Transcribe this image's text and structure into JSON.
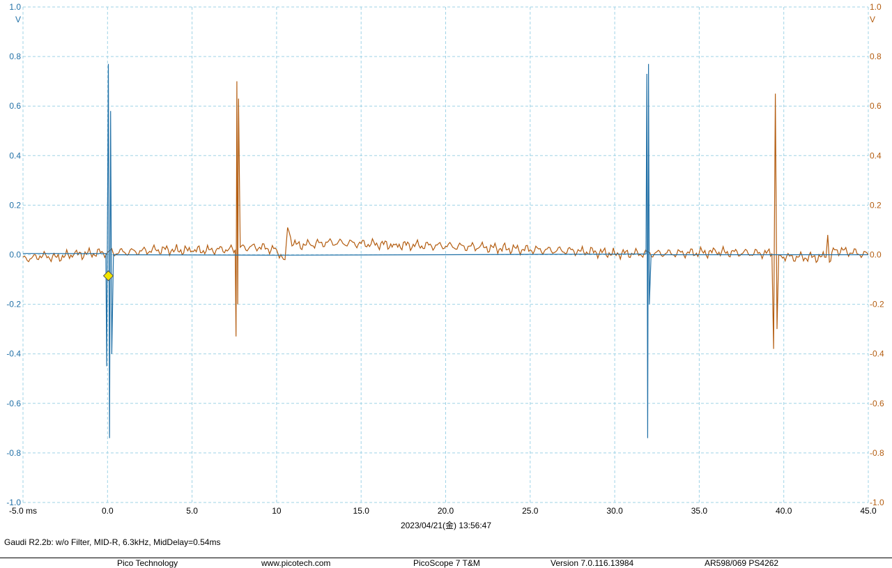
{
  "chart_data": {
    "type": "line",
    "title": "",
    "timestamp": "2023/04/21(金) 13:56:47",
    "xlabel": "",
    "x_unit": "ms",
    "xlim": [
      -5.0,
      45.0
    ],
    "x_ticks": [
      -5,
      0,
      5,
      10,
      15,
      20,
      25,
      30,
      35,
      40,
      45
    ],
    "x_tick_labels": [
      "-5.0 ms",
      "0.0",
      "5.0",
      "10",
      "15.0",
      "20.0",
      "25.0",
      "30.0",
      "35.0",
      "40.0",
      "45.0"
    ],
    "left_axis": {
      "unit": "V",
      "ylim": [
        -1.0,
        1.0
      ],
      "ticks": [
        1.0,
        0.8,
        0.6,
        0.4,
        0.2,
        0.0,
        -0.2,
        -0.4,
        -0.6,
        -0.8,
        -1.0
      ],
      "tick_labels": [
        "1.0",
        "0.8",
        "0.6",
        "0.4",
        "0.2",
        "0.0",
        "-0.2",
        "-0.4",
        "-0.6",
        "-0.8",
        "-1.0"
      ],
      "color": "#1f6fa6"
    },
    "right_axis": {
      "unit": "V",
      "ylim": [
        -1.0,
        1.0
      ],
      "ticks": [
        1.0,
        0.8,
        0.6,
        0.4,
        0.2,
        0.0,
        -0.2,
        -0.4,
        -0.6,
        -0.8,
        -1.0
      ],
      "tick_labels": [
        "1.0",
        "0.8",
        "0.6",
        "0.4",
        "0.2",
        "0.0",
        "-0.2",
        "-0.4",
        "-0.6",
        "-0.8",
        "-1.0"
      ],
      "color": "#b35c0f"
    },
    "grid": true,
    "grid_color": "#9fd3e6",
    "series": [
      {
        "color": "#1f6fa6",
        "points": [
          [
            -5.0,
            0.005
          ],
          [
            -0.1,
            0.005
          ],
          [
            -0.05,
            -0.45
          ],
          [
            0.05,
            0.77
          ],
          [
            0.12,
            -0.74
          ],
          [
            0.18,
            0.58
          ],
          [
            0.25,
            -0.4
          ],
          [
            0.35,
            0.0
          ],
          [
            10.0,
            -0.002
          ],
          [
            20.0,
            0.0
          ],
          [
            31.85,
            0.003
          ],
          [
            31.9,
            0.73
          ],
          [
            31.95,
            -0.74
          ],
          [
            32.0,
            0.77
          ],
          [
            32.05,
            -0.2
          ],
          [
            32.15,
            0.0
          ],
          [
            45.0,
            0.0
          ]
        ]
      },
      {
        "color": "#b35c0f",
        "points": [
          [
            -5.0,
            -0.01
          ],
          [
            -4.5,
            -0.015
          ],
          [
            -4.0,
            -0.005
          ],
          [
            -3.0,
            -0.01
          ],
          [
            -2.0,
            0.0
          ],
          [
            -1.0,
            0.005
          ],
          [
            0.0,
            0.01
          ],
          [
            1.0,
            0.01
          ],
          [
            2.0,
            0.015
          ],
          [
            3.0,
            0.02
          ],
          [
            4.0,
            0.02
          ],
          [
            5.0,
            0.015
          ],
          [
            6.0,
            0.02
          ],
          [
            7.0,
            0.02
          ],
          [
            7.55,
            0.02
          ],
          [
            7.6,
            -0.33
          ],
          [
            7.65,
            0.7
          ],
          [
            7.7,
            -0.2
          ],
          [
            7.75,
            0.63
          ],
          [
            7.85,
            0.03
          ],
          [
            9.0,
            0.03
          ],
          [
            10.0,
            0.02
          ],
          [
            10.5,
            -0.02
          ],
          [
            10.65,
            0.11
          ],
          [
            11.0,
            0.04
          ],
          [
            12.0,
            0.04
          ],
          [
            13.0,
            0.05
          ],
          [
            15.0,
            0.045
          ],
          [
            17.0,
            0.04
          ],
          [
            20.0,
            0.035
          ],
          [
            22.0,
            0.03
          ],
          [
            25.0,
            0.02
          ],
          [
            28.0,
            0.015
          ],
          [
            30.0,
            0.005
          ],
          [
            33.0,
            0.005
          ],
          [
            36.0,
            0.01
          ],
          [
            39.3,
            0.005
          ],
          [
            39.4,
            -0.38
          ],
          [
            39.5,
            0.65
          ],
          [
            39.6,
            -0.3
          ],
          [
            39.7,
            0.0
          ],
          [
            40.0,
            -0.01
          ],
          [
            42.5,
            -0.01
          ],
          [
            42.6,
            0.08
          ],
          [
            42.7,
            -0.03
          ],
          [
            43.0,
            0.02
          ],
          [
            45.0,
            0.0
          ]
        ]
      }
    ],
    "trigger_marker": {
      "x": 0.05,
      "y": -0.085,
      "color": "#f2e600"
    }
  },
  "caption": "Gaudi R2.2b: w/o Filter, MID-R, 6.3kHz, MidDelay=0.54ms",
  "footer": {
    "company": "Pico Technology",
    "website": "www.picotech.com",
    "product": "PicoScope 7 T&M",
    "version": "Version 7.0.116.13984",
    "device": "AR598/069 PS4262"
  }
}
